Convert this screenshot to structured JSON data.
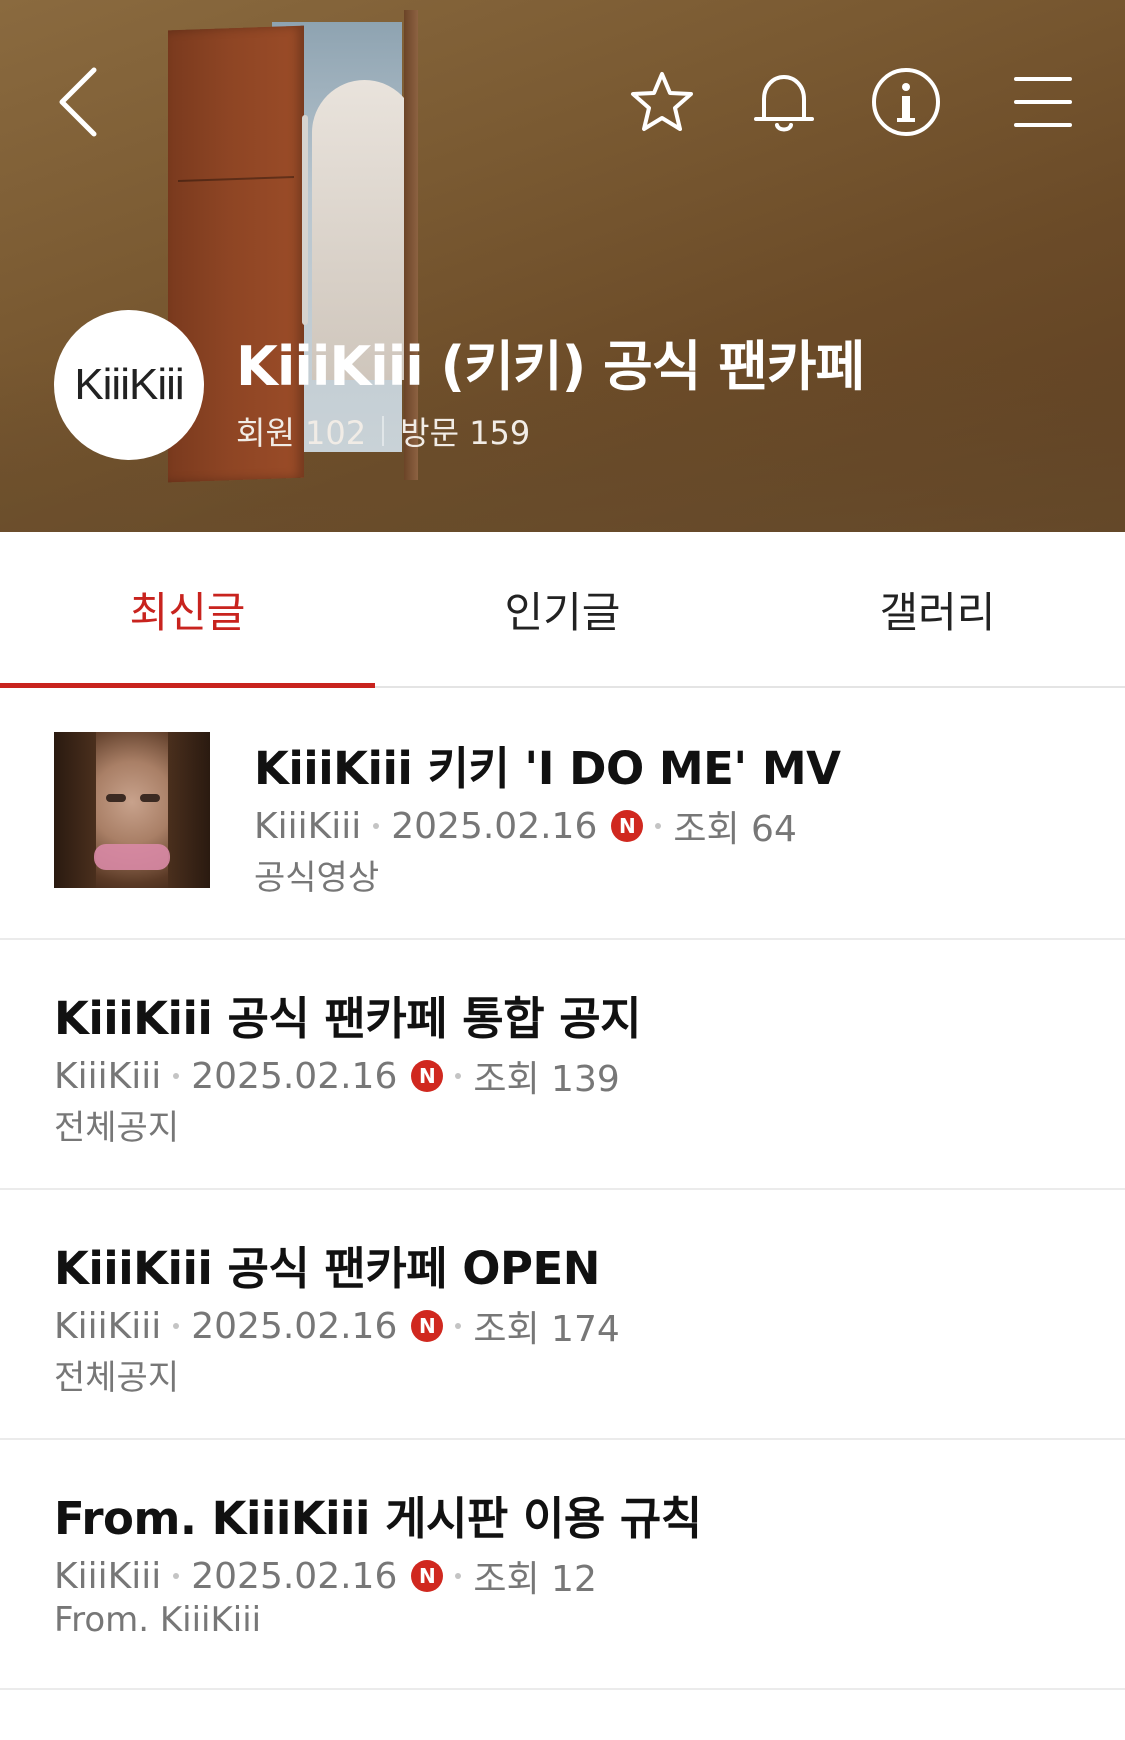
{
  "colors": {
    "accent": "#c8231e",
    "new_badge": "#d0281f",
    "meta_text": "#777777",
    "hero_brown": "#7a5a32"
  },
  "header": {
    "back_icon": "chevron-left-icon",
    "actions": [
      {
        "name": "favorite",
        "icon": "star-icon"
      },
      {
        "name": "notifications",
        "icon": "bell-icon"
      },
      {
        "name": "info",
        "icon": "info-icon"
      },
      {
        "name": "menu",
        "icon": "hamburger-menu-icon"
      }
    ],
    "logo_text": "KiiiKiii",
    "cafe_title": "KiiiKiii (키키) 공식 팬카페",
    "members_label": "회원 102",
    "visits_label": "방문 159"
  },
  "tabs": [
    {
      "label": "최신글",
      "active": true
    },
    {
      "label": "인기글",
      "active": false
    },
    {
      "label": "갤러리",
      "active": false
    }
  ],
  "posts": [
    {
      "title": "KiiiKiii 키키 'I DO ME' MV",
      "author": "KiiiKiii",
      "date": "2025.02.16",
      "badge": "N",
      "views": "조회 64",
      "category": "공식영상",
      "has_thumbnail": true
    },
    {
      "title": "KiiiKiii 공식 팬카페 통합 공지",
      "author": "KiiiKiii",
      "date": "2025.02.16",
      "badge": "N",
      "views": "조회 139",
      "category": "전체공지",
      "has_thumbnail": false
    },
    {
      "title": "KiiiKiii 공식 팬카페 OPEN",
      "author": "KiiiKiii",
      "date": "2025.02.16",
      "badge": "N",
      "views": "조회 174",
      "category": "전체공지",
      "has_thumbnail": false
    },
    {
      "title": "From. KiiiKiii 게시판 이용 규칙",
      "author": "KiiiKiii",
      "date": "2025.02.16",
      "badge": "N",
      "views": "조회 12",
      "category": "From. KiiiKiii",
      "has_thumbnail": false
    }
  ]
}
